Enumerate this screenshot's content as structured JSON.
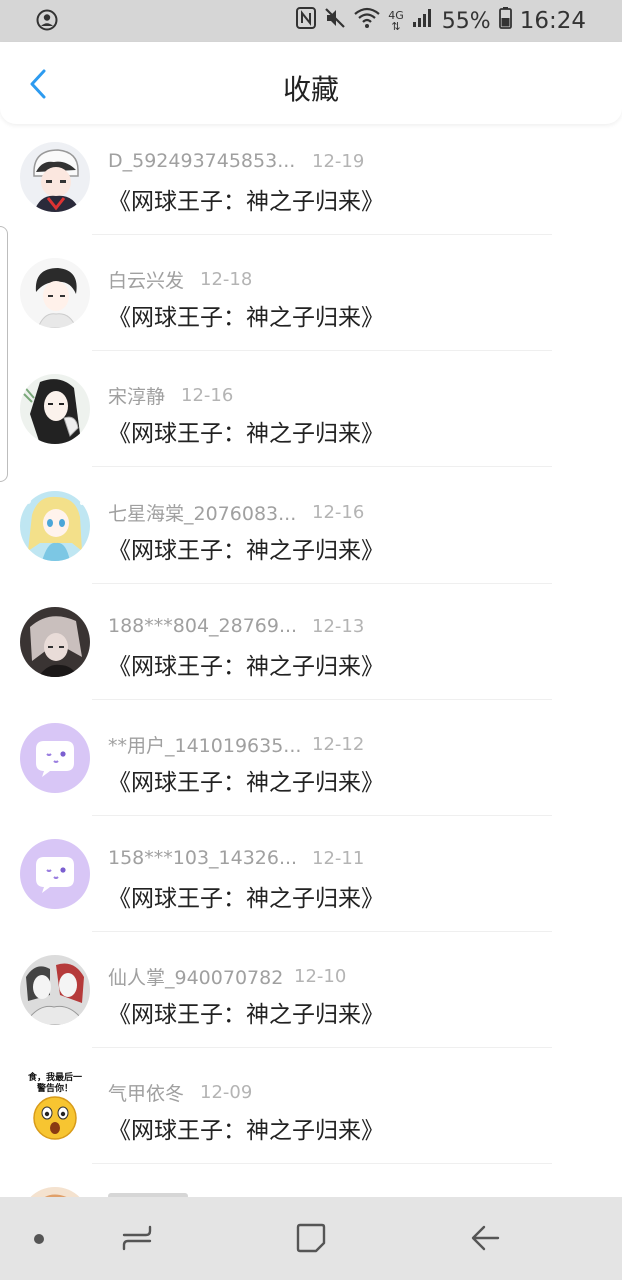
{
  "status_bar": {
    "battery": "55%",
    "time": "16:24",
    "network": "4G",
    "icons": [
      "account-circle-icon",
      "nfc-icon",
      "mute-icon",
      "wifi-icon",
      "signal-icon",
      "battery-icon"
    ]
  },
  "header": {
    "title": "收藏",
    "back_icon": "chevron-left-icon",
    "accent": "#2d9bf0"
  },
  "items": [
    {
      "user": "D_592493745853...",
      "date": "12-19",
      "book": "《网球王子：神之子归来》",
      "avatar": "anime-boy-cap"
    },
    {
      "user": "白云兴发",
      "date": "12-18",
      "book": "《网球王子：神之子归来》",
      "avatar": "anime-boy-sketch"
    },
    {
      "user": "宋淳静",
      "date": "12-16",
      "book": "《网球王子：神之子归来》",
      "avatar": "anime-girl-dark-hair"
    },
    {
      "user": "七星海棠_2076083...",
      "date": "12-16",
      "book": "《网球王子：神之子归来》",
      "avatar": "anime-girl-blonde"
    },
    {
      "user": "188***804_28769...",
      "date": "12-13",
      "book": "《网球王子：神之子归来》",
      "avatar": "anime-boy-grey"
    },
    {
      "user": "**用户_141019635...",
      "date": "12-12",
      "book": "《网球王子：神之子归来》",
      "avatar": "default-chat-bubble"
    },
    {
      "user": "158***103_14326...",
      "date": "12-11",
      "book": "《网球王子：神之子归来》",
      "avatar": "default-chat-bubble"
    },
    {
      "user": "仙人掌_940070782",
      "date": "12-10",
      "book": "《网球王子：神之子归来》",
      "avatar": "anime-couple"
    },
    {
      "user": "气甲依冬",
      "date": "12-09",
      "book": "《网球王子：神之子归来》",
      "avatar": "emoji-shocked-face"
    }
  ],
  "meme_text": {
    "line1": "食，我最后一",
    "line2": "警告你！"
  },
  "nav_bar": {
    "icons": [
      "dot-icon",
      "recents-icon",
      "home-icon",
      "back-icon"
    ]
  }
}
